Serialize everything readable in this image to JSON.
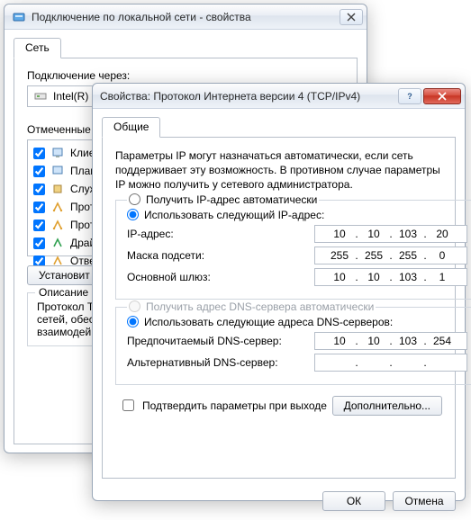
{
  "back": {
    "title": "Подключение по локальной сети - свойства",
    "tab": "Сеть",
    "connect_via_label": "Подключение через:",
    "adapter": "Intel(R) I",
    "components_label": "Отмеченные ко",
    "items": [
      {
        "label": "Клиен",
        "checked": true,
        "icon": "client"
      },
      {
        "label": "План",
        "checked": true,
        "icon": "sched"
      },
      {
        "label": "Служ",
        "checked": true,
        "icon": "service"
      },
      {
        "label": "Прото",
        "checked": true,
        "icon": "proto"
      },
      {
        "label": "Прото",
        "checked": true,
        "icon": "proto"
      },
      {
        "label": "Драй",
        "checked": true,
        "icon": "driver"
      },
      {
        "label": "Отве",
        "checked": true,
        "icon": "proto"
      }
    ],
    "install_btn": "Установит",
    "desc_title": "Описание",
    "desc_lines": [
      "Протокол Т",
      "сетей, обес",
      "взаимодей"
    ]
  },
  "front": {
    "title": "Свойства: Протокол Интернета версии 4 (TCP/IPv4)",
    "tab": "Общие",
    "intro": "Параметры IP могут назначаться автоматически, если сеть поддерживает эту возможность. В противном случае параметры IP можно получить у сетевого администратора.",
    "ip_group": {
      "auto_label": "Получить IP-адрес автоматически",
      "manual_label": "Использовать следующий IP-адрес:",
      "selected": "manual",
      "fields": {
        "ip_label": "IP-адрес:",
        "ip": [
          "10",
          "10",
          "103",
          "20"
        ],
        "mask_label": "Маска подсети:",
        "mask": [
          "255",
          "255",
          "255",
          "0"
        ],
        "gw_label": "Основной шлюз:",
        "gw": [
          "10",
          "10",
          "103",
          "1"
        ]
      }
    },
    "dns_group": {
      "auto_label": "Получить адрес DNS-сервера автоматически",
      "manual_label": "Использовать следующие адреса DNS-серверов:",
      "selected": "manual",
      "fields": {
        "pref_label": "Предпочитаемый DNS-сервер:",
        "pref": [
          "10",
          "10",
          "103",
          "254"
        ],
        "alt_label": "Альтернативный DNS-сервер:",
        "alt": [
          "",
          "",
          "",
          ""
        ]
      }
    },
    "validate_label": "Подтвердить параметры при выходе",
    "advanced_btn": "Дополнительно...",
    "ok": "ОК",
    "cancel": "Отмена"
  }
}
